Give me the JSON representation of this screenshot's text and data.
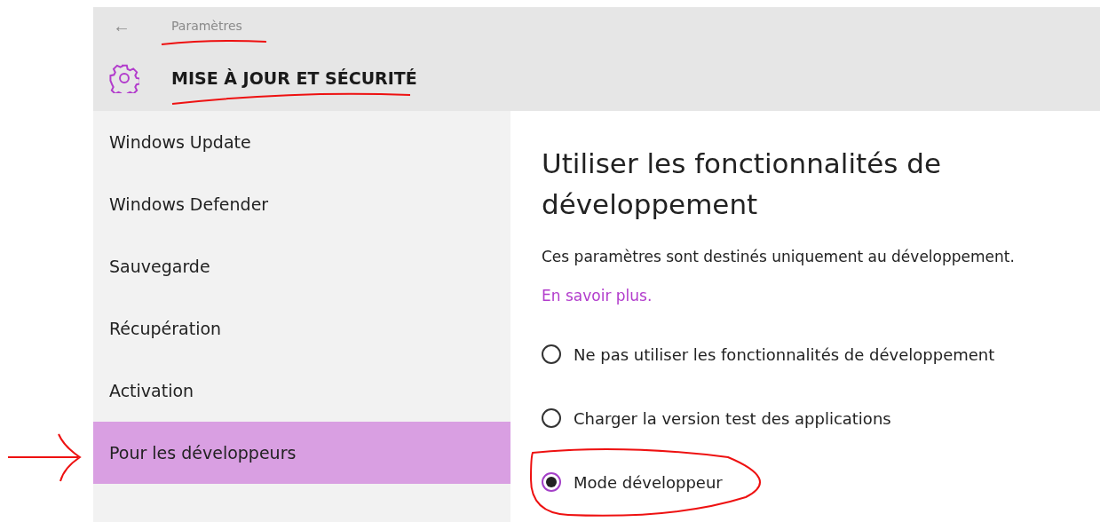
{
  "header": {
    "back": "←",
    "app_title": "Paramètres",
    "section_title": "MISE À JOUR ET SÉCURITÉ"
  },
  "sidebar": {
    "items": [
      {
        "label": "Windows Update",
        "selected": false
      },
      {
        "label": "Windows Defender",
        "selected": false
      },
      {
        "label": "Sauvegarde",
        "selected": false
      },
      {
        "label": "Récupération",
        "selected": false
      },
      {
        "label": "Activation",
        "selected": false
      },
      {
        "label": "Pour les développeurs",
        "selected": true
      }
    ]
  },
  "content": {
    "title": "Utiliser les fonctionnalités de développement",
    "description": "Ces paramètres sont destinés uniquement au développement.",
    "link": "En savoir plus.",
    "options": [
      {
        "label": "Ne pas utiliser les fonctionnalités de développement",
        "selected": false
      },
      {
        "label": "Charger la version test des applications",
        "selected": false
      },
      {
        "label": "Mode développeur",
        "selected": true
      }
    ]
  }
}
